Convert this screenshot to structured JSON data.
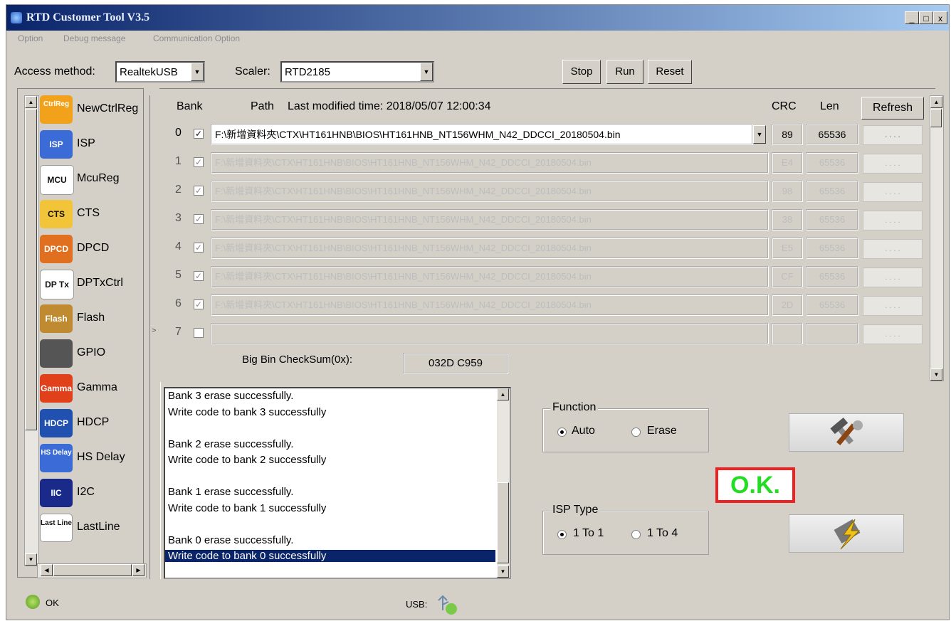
{
  "window": {
    "title": "RTD Customer Tool V3.5"
  },
  "menu": [
    "Option",
    "Debug message",
    "Communication Option"
  ],
  "toolbar": {
    "access_label": "Access method:",
    "access_value": "RealtekUSB",
    "scaler_label": "Scaler:",
    "scaler_value": "RTD2185",
    "stop": "Stop",
    "run": "Run",
    "reset": "Reset"
  },
  "nav": [
    {
      "label": "NewCtrlReg",
      "icon": "ctrlreg-icon",
      "badge": "CtrlReg",
      "color": "#f2a21a"
    },
    {
      "label": "ISP",
      "icon": "isp-icon",
      "badge": "ISP",
      "color": "#3a6bd6"
    },
    {
      "label": "McuReg",
      "icon": "mcu-icon",
      "badge": "MCU",
      "color": "#ffffff"
    },
    {
      "label": "CTS",
      "icon": "cts-icon",
      "badge": "CTS",
      "color": "#f2c43a"
    },
    {
      "label": "DPCD",
      "icon": "dpcd-icon",
      "badge": "DPCD",
      "color": "#e07020"
    },
    {
      "label": "DPTxCtrl",
      "icon": "dptx-icon",
      "badge": "DP Tx",
      "color": "#ffffff"
    },
    {
      "label": "Flash",
      "icon": "flash-icon",
      "badge": "Flash",
      "color": "#c08a30"
    },
    {
      "label": "GPIO",
      "icon": "gpio-icon",
      "badge": "",
      "color": "#555555"
    },
    {
      "label": "Gamma",
      "icon": "gamma-icon",
      "badge": "Gamma",
      "color": "#e0401a"
    },
    {
      "label": "HDCP",
      "icon": "hdcp-icon",
      "badge": "HDCP",
      "color": "#2050b0"
    },
    {
      "label": "HS Delay",
      "icon": "hsdelay-icon",
      "badge": "HS Delay",
      "color": "#3a6bd6"
    },
    {
      "label": "I2C",
      "icon": "i2c-icon",
      "badge": "IIC",
      "color": "#1a2a8a"
    },
    {
      "label": "LastLine",
      "icon": "lastline-icon",
      "badge": "Last Line",
      "color": "#ffffff"
    }
  ],
  "banks": {
    "header": {
      "bank": "Bank",
      "path": "Path",
      "modified": "Last modified time: 2018/05/07 12:00:34",
      "crc": "CRC",
      "len": "Len",
      "refresh": "Refresh"
    },
    "rows": [
      {
        "num": "0",
        "checked": true,
        "path": "F:\\新增資料夾\\CTX\\HT161HNB\\BIOS\\HT161HNB_NT156WHM_N42_DDCCI_20180504.bin",
        "crc": "89",
        "len": "65536",
        "dots": ". . . ."
      },
      {
        "num": "1",
        "checked": true,
        "path": "F:\\新增資料夾\\CTX\\HT161HNB\\BIOS\\HT161HNB_NT156WHM_N42_DDCCI_20180504.bin",
        "crc": "E4",
        "len": "65536",
        "dots": ". . . ."
      },
      {
        "num": "2",
        "checked": true,
        "path": "F:\\新增資料夾\\CTX\\HT161HNB\\BIOS\\HT161HNB_NT156WHM_N42_DDCCI_20180504.bin",
        "crc": "98",
        "len": "65536",
        "dots": ". . . ."
      },
      {
        "num": "3",
        "checked": true,
        "path": "F:\\新增資料夾\\CTX\\HT161HNB\\BIOS\\HT161HNB_NT156WHM_N42_DDCCI_20180504.bin",
        "crc": "38",
        "len": "65536",
        "dots": ". . . ."
      },
      {
        "num": "4",
        "checked": true,
        "path": "F:\\新增資料夾\\CTX\\HT161HNB\\BIOS\\HT161HNB_NT156WHM_N42_DDCCI_20180504.bin",
        "crc": "E5",
        "len": "65536",
        "dots": ". . . ."
      },
      {
        "num": "5",
        "checked": true,
        "path": "F:\\新增資料夾\\CTX\\HT161HNB\\BIOS\\HT161HNB_NT156WHM_N42_DDCCI_20180504.bin",
        "crc": "CF",
        "len": "65536",
        "dots": ". . . ."
      },
      {
        "num": "6",
        "checked": true,
        "path": "F:\\新增資料夾\\CTX\\HT161HNB\\BIOS\\HT161HNB_NT156WHM_N42_DDCCI_20180504.bin",
        "crc": "2D",
        "len": "65536",
        "dots": ". . . ."
      },
      {
        "num": "7",
        "checked": false,
        "path": "",
        "crc": "",
        "len": "",
        "dots": ". . . ."
      }
    ],
    "checksum_label": "Big Bin CheckSum(0x):",
    "checksum_value": "032D C959"
  },
  "log": [
    "Bank 3 erase successfully.",
    "Write code to bank 3 successfully",
    "",
    "Bank 2 erase successfully.",
    "Write code to bank 2 successfully",
    "",
    "Bank 1 erase successfully.",
    "Write code to bank 1 successfully",
    "",
    "Bank 0 erase successfully.",
    "Write code to bank 0 successfully"
  ],
  "function": {
    "title": "Function",
    "auto": "Auto",
    "erase": "Erase",
    "selected": "Auto"
  },
  "isp_type": {
    "title": "ISP Type",
    "one_to_one": "1 To 1",
    "one_to_four": "1 To 4",
    "selected": "1 To 1"
  },
  "result": "O.K.",
  "status": {
    "ok": "OK",
    "usb": "USB:"
  },
  "colors": {
    "ok_text": "#22dd22",
    "ok_border": "#e22222",
    "selection": "#0a246a"
  }
}
